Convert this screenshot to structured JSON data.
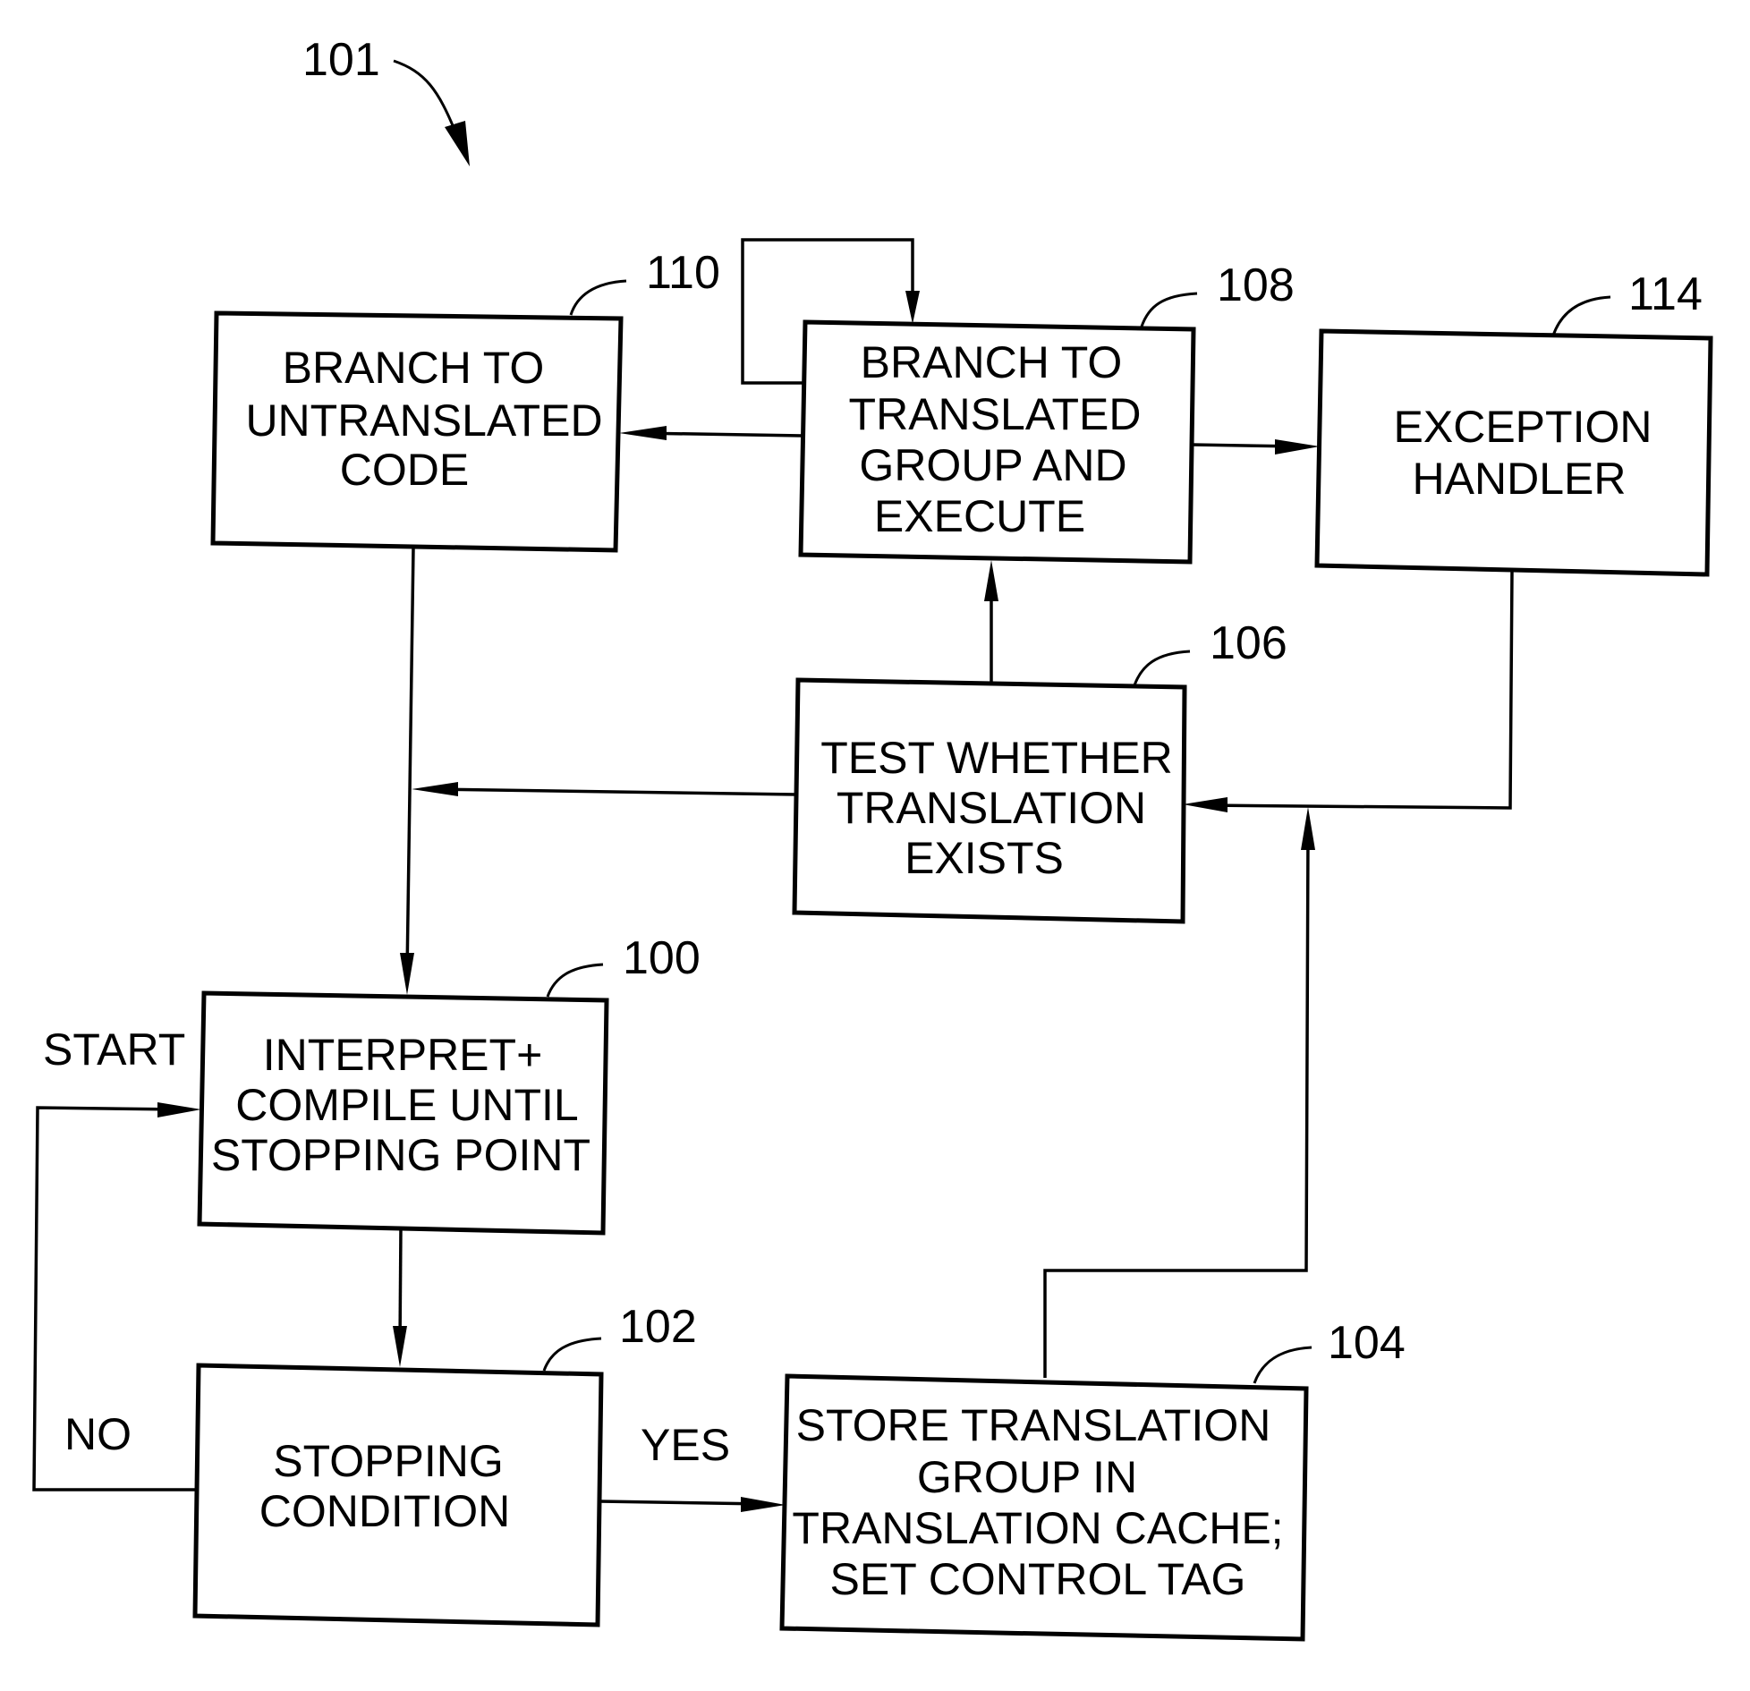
{
  "figure": {
    "reference": "101",
    "nodes": [
      {
        "id": "110",
        "label": [
          "BRANCH TO",
          "UNTRANSLATED",
          "CODE"
        ]
      },
      {
        "id": "108",
        "label": [
          "BRANCH TO",
          "TRANSLATED",
          "GROUP AND",
          "EXECUTE"
        ]
      },
      {
        "id": "114",
        "label": [
          "EXCEPTION",
          "HANDLER"
        ]
      },
      {
        "id": "106",
        "label": [
          "TEST WHETHER",
          "TRANSLATION",
          "EXISTS"
        ]
      },
      {
        "id": "100",
        "label": [
          "INTERPRET+",
          "COMPILE UNTIL",
          "STOPPING POINT"
        ]
      },
      {
        "id": "102",
        "label": [
          "STOPPING",
          "CONDITION"
        ]
      },
      {
        "id": "104",
        "label": [
          "STORE TRANSLATION",
          "GROUP IN",
          "TRANSLATION CACHE;",
          "SET CONTROL TAG"
        ]
      }
    ],
    "edge_labels": {
      "start": "START",
      "no": "NO",
      "yes": "YES"
    }
  }
}
